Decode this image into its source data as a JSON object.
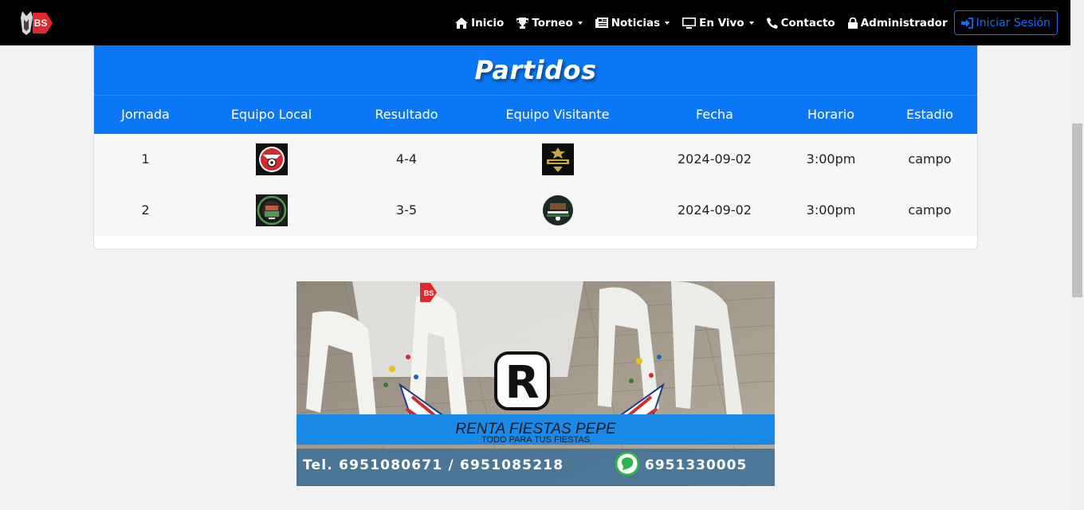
{
  "navbar": {
    "logo_text": "BS",
    "items": [
      {
        "label": "Inicio",
        "icon": "home-icon",
        "dropdown": false
      },
      {
        "label": "Torneo",
        "icon": "trophy-icon",
        "dropdown": true
      },
      {
        "label": "Noticias",
        "icon": "newspaper-icon",
        "dropdown": true
      },
      {
        "label": "En Vivo",
        "icon": "tv-icon",
        "dropdown": true
      },
      {
        "label": "Contacto",
        "icon": "phone-icon",
        "dropdown": false
      },
      {
        "label": "Administrador",
        "icon": "lock-icon",
        "dropdown": false
      }
    ],
    "login_label": "Iniciar Sesión"
  },
  "matches": {
    "title": "Partidos",
    "columns": [
      "Jornada",
      "Equipo Local",
      "Resultado",
      "Equipo Visitante",
      "Fecha",
      "Horario",
      "Estadio"
    ],
    "rows": [
      {
        "jornada": "1",
        "local_logo": "team-logo-red",
        "resultado": "4-4",
        "visitante_logo": "team-logo-mineros",
        "fecha": "2024-09-02",
        "horario": "3:00pm",
        "estadio": "campo"
      },
      {
        "jornada": "2",
        "local_logo": "team-logo-green",
        "resultado": "3-5",
        "visitante_logo": "team-logo-vallenato",
        "fecha": "2024-09-02",
        "horario": "3:00pm",
        "estadio": "campo"
      }
    ]
  },
  "ad": {
    "logo_letter": "R",
    "logo_badge": "BS",
    "business_name": "RENTA FIESTAS PEPE",
    "tagline": "TODO PARA TUS FIESTAS",
    "phones": "Tel. 6951080671 / 6951085218",
    "whatsapp": "6951330005"
  },
  "colors": {
    "navbar_bg": "#000000",
    "primary_blue": "#0a78f5",
    "login_blue": "#0d6efd",
    "brand_red": "#e0282e"
  }
}
